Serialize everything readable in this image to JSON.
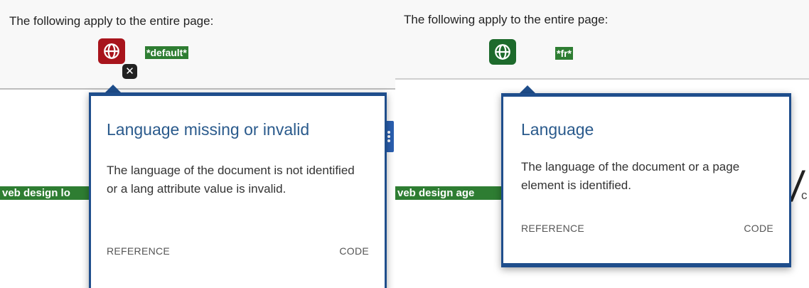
{
  "left": {
    "scope_text": "The following apply to the entire page:",
    "lang_tag": "*default*",
    "error_badge": "✕",
    "snippet": "veb design lo",
    "tooltip": {
      "title": "Language missing or invalid",
      "description": "The language of the document is not identified or a lang attribute value is invalid.",
      "reference": "REFERENCE",
      "code": "CODE"
    }
  },
  "right": {
    "scope_text": "The following apply to the entire page:",
    "lang_tag": "*fr*",
    "snippet": "veb design age",
    "fragment": "c",
    "tooltip": {
      "title": "Language",
      "description": "The language of the document or a page element is identified.",
      "reference": "REFERENCE",
      "code": "CODE"
    }
  },
  "colors": {
    "error_red": "#a8141c",
    "success_green": "#1d6a2c",
    "tag_green": "#2e7d32",
    "tooltip_border": "#1f4e8c",
    "title_blue": "#2a5a8c"
  },
  "icons": {
    "language_icon": "globe-icon",
    "error_badge_icon": "close-icon"
  }
}
